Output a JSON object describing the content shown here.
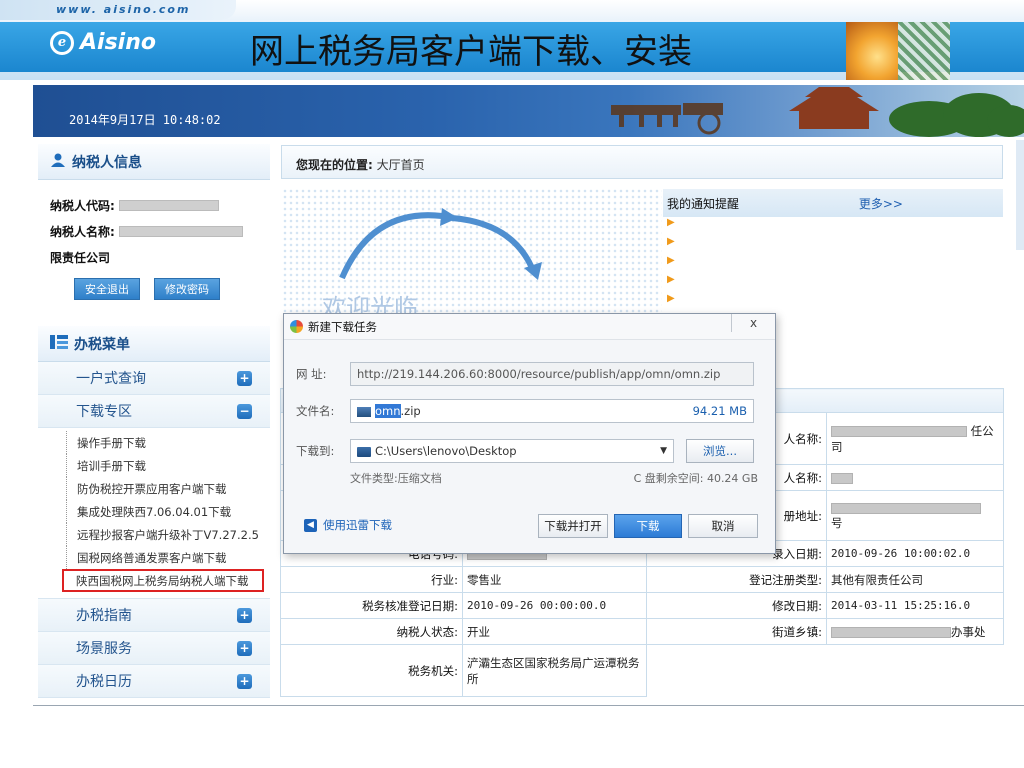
{
  "slide": {
    "url_text": "www. aisino.com",
    "logo_text": "Aisino",
    "title": "网上税务局客户端下载、安装"
  },
  "banner": {
    "datetime": "2014年9月17日 10:48:02"
  },
  "taxpayer": {
    "heading": "纳税人信息",
    "code_label": "纳税人代码:",
    "name_label": "纳税人名称:",
    "name_suffix": "限责任公司",
    "logout_button": "安全退出",
    "change_password_button": "修改密码"
  },
  "menu": {
    "heading": "办税菜单",
    "groups": [
      {
        "label": "一户式查询",
        "toggle": "+"
      },
      {
        "label": "下载专区",
        "toggle": "−"
      }
    ],
    "download_items": [
      "操作手册下载",
      "培训手册下载",
      "防伪税控开票应用客户端下载",
      "集成处理陕西7.06.04.01下载",
      "远程抄报客户端升级补丁V7.27.2.5",
      "国税网络普通发票客户端下载",
      "陕西国税网上税务局纳税人端下载"
    ],
    "bottom_groups": [
      {
        "label": "办税指南",
        "toggle": "+"
      },
      {
        "label": "场景服务",
        "toggle": "+"
      },
      {
        "label": "办税日历",
        "toggle": "+"
      }
    ]
  },
  "location": {
    "label": "您现在的位置:",
    "value": "大厅首页"
  },
  "welcome": {
    "text": "欢迎光临"
  },
  "notice": {
    "title": "我的通知提醒",
    "more": "更多>>"
  },
  "info_table": {
    "rows": [
      {
        "k1": "",
        "v1": "",
        "k2": "人名称:",
        "v2": "任公司"
      },
      {
        "k1": "",
        "v1": "",
        "k2": "人名称:",
        "v2": ""
      },
      {
        "k1": "",
        "v1": "",
        "k2": "册地址:",
        "v2": "号"
      },
      {
        "k1": "电话号码:",
        "v1": "",
        "k2": "录入日期:",
        "v2": "2010-09-26 10:00:02.0"
      },
      {
        "k1": "行业:",
        "v1": "零售业",
        "k2": "登记注册类型:",
        "v2": "其他有限责任公司"
      },
      {
        "k1": "税务核准登记日期:",
        "v1": "2010-09-26 00:00:00.0",
        "k2": "修改日期:",
        "v2": "2014-03-11 15:25:16.0"
      },
      {
        "k1": "纳税人状态:",
        "v1": "开业",
        "k2": "街道乡镇:",
        "v2": "办事处"
      },
      {
        "k1": "税务机关:",
        "v1": "浐灞生态区国家税务局广运潭税务所",
        "k2": "",
        "v2": ""
      }
    ]
  },
  "dialog": {
    "title": "新建下载任务",
    "close": "x",
    "url_label": "网 址:",
    "url_value": "http://219.144.206.60:8000/resource/publish/app/omn/omn.zip",
    "filename_label": "文件名:",
    "filename_selected": "omn",
    "filename_ext": ".zip",
    "filesize": "94.21 MB",
    "saveto_label": "下载到:",
    "saveto_value": "C:\\Users\\lenovo\\Desktop",
    "browse_button": "浏览...",
    "filetype": "文件类型:压缩文档",
    "freespace": "C 盘剩余空间: 40.24 GB",
    "thunder_link": "使用迅雷下载",
    "open_button": "下载并打开",
    "download_button": "下载",
    "cancel_button": "取消"
  },
  "colors": {
    "banner_dark": "#1f4f93",
    "accent_blue": "#2c7bd6",
    "highlight_red": "#d22222"
  }
}
